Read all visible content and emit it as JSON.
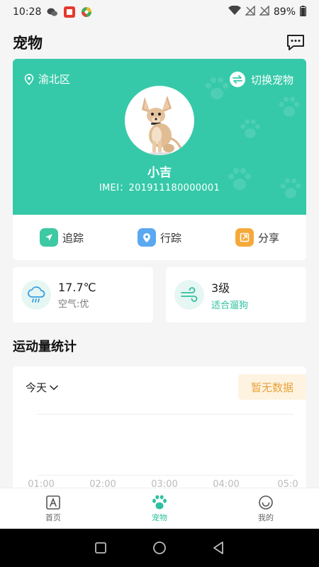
{
  "status_bar": {
    "time": "10:28",
    "battery": "89%"
  },
  "header": {
    "title": "宠物"
  },
  "pet_card": {
    "location": "渝北区",
    "switch_label": "切换宠物",
    "pet_name": "小吉",
    "imei": "IMEI：201911180000001",
    "bg_color": "#35c9a9"
  },
  "actions": [
    {
      "label": "追踪",
      "icon": "navigation-icon",
      "color": "#3cc9a3"
    },
    {
      "label": "行踪",
      "icon": "location-pin-icon",
      "color": "#5aa8f0"
    },
    {
      "label": "分享",
      "icon": "share-icon",
      "color": "#f5a93b"
    }
  ],
  "weather": {
    "temperature": "17.7℃",
    "air_quality": "空气:优",
    "icon": "rain-cloud-icon"
  },
  "wind": {
    "level": "3级",
    "advice": "适合遛狗",
    "icon": "wind-icon"
  },
  "stats": {
    "title": "运动量统计",
    "period": "今天",
    "no_data": "暂无数据",
    "x_ticks": [
      "01:00",
      "02:00",
      "03:00",
      "04:00",
      "05:0"
    ]
  },
  "bottom_nav": [
    {
      "label": "首页",
      "icon": "home-icon"
    },
    {
      "label": "宠物",
      "icon": "paw-icon"
    },
    {
      "label": "我的",
      "icon": "smile-icon"
    }
  ]
}
